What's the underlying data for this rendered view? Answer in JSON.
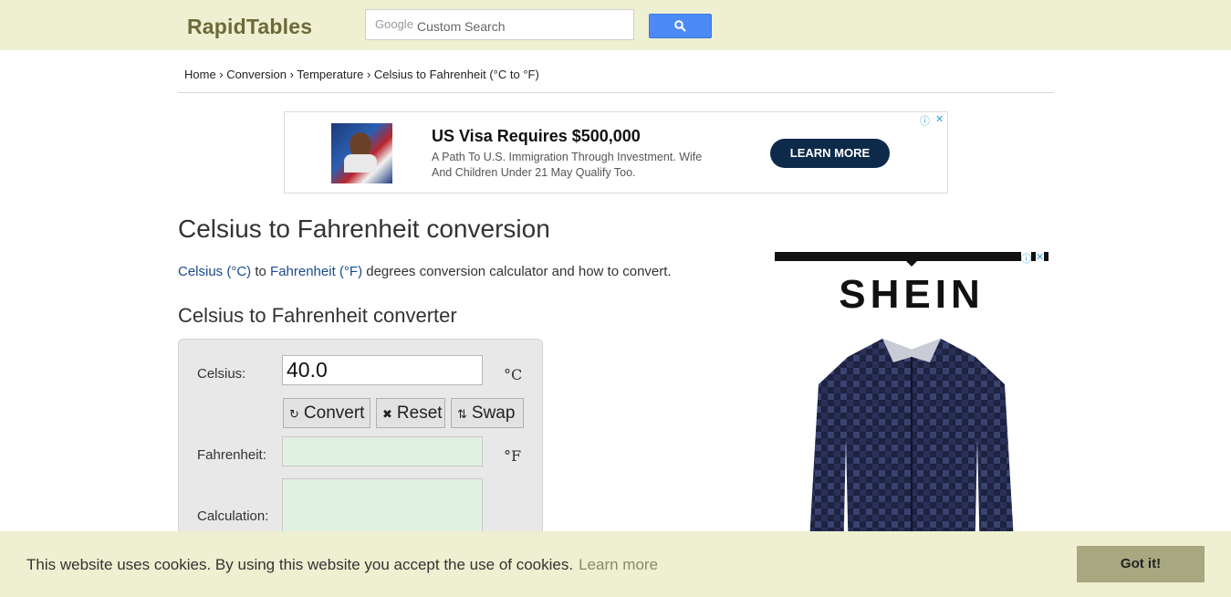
{
  "header": {
    "logo": "RapidTables",
    "search": {
      "google_label": "Google",
      "placeholder": "Custom Search"
    }
  },
  "breadcrumb": {
    "home": "Home",
    "sep1": " › ",
    "conversion": "Conversion",
    "sep2": " › ",
    "temperature": "Temperature",
    "sep3": " › ",
    "current": "Celsius to Fahrenheit (°C to °F)"
  },
  "ad_top": {
    "headline": "US Visa Requires $500,000",
    "body": "A Path To U.S. Immigration Through Investment. Wife And Children Under 21 May Qualify Too.",
    "cta": "LEARN MORE",
    "info_icon": "ⓘ",
    "close_icon": "✕"
  },
  "main": {
    "title": "Celsius to Fahrenheit conversion",
    "intro_link1": "Celsius (°C)",
    "intro_to": " to ",
    "intro_link2": "Fahrenheit (°F)",
    "intro_rest": " degrees conversion calculator and how to convert.",
    "converter_title": "Celsius to Fahrenheit converter"
  },
  "converter": {
    "celsius_label": "Celsius:",
    "celsius_value": "40.0",
    "celsius_unit": "°C",
    "convert_label": "Convert",
    "reset_label": "Reset",
    "swap_label": "Swap",
    "fahrenheit_label": "Fahrenheit:",
    "fahrenheit_unit": "°F",
    "calculation_label": "Calculation:"
  },
  "ad_side": {
    "brand": "SHEIN",
    "info_icon": "ⓘ",
    "close_icon": "✕"
  },
  "cookie": {
    "message": "This website uses cookies. By using this website you accept the use of cookies.",
    "learn_more": "Learn more",
    "accept": "Got it!"
  },
  "colors": {
    "header_bg": "#efefd1",
    "link": "#1a4a8a",
    "search_button": "#4c8bf5",
    "output_bg": "#e1f1e1",
    "accept_button": "#a8a880"
  }
}
